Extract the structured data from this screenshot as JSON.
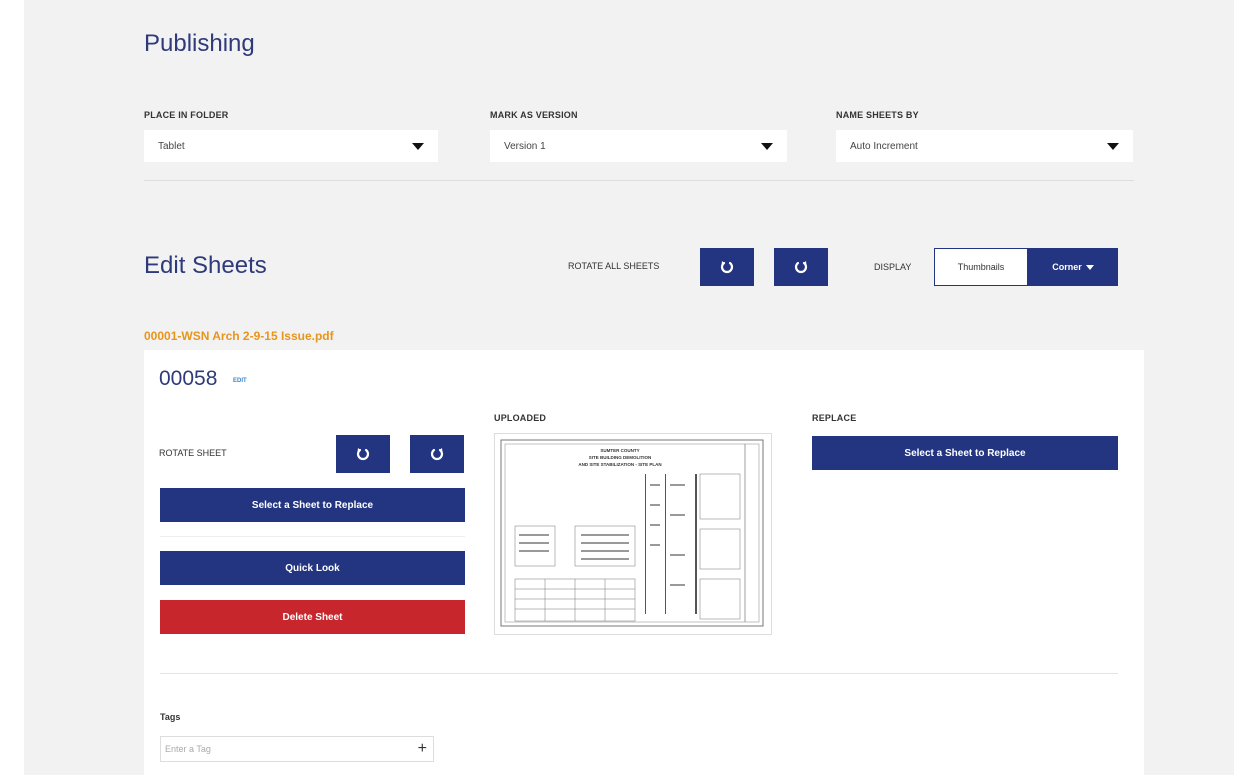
{
  "publishing": {
    "title": "Publishing",
    "place_in_folder": {
      "label": "PLACE IN FOLDER",
      "value": "Tablet"
    },
    "mark_as_version": {
      "label": "MARK AS VERSION",
      "value": "Version 1"
    },
    "name_sheets_by": {
      "label": "NAME SHEETS BY",
      "value": "Auto Increment"
    }
  },
  "edit_sheets": {
    "title": "Edit Sheets",
    "rotate_all_label": "ROTATE ALL SHEETS",
    "display_label": "DISPLAY",
    "display_options": {
      "thumbnails": "Thumbnails",
      "corner": "Corner"
    },
    "file_name": "00001-WSN Arch 2-9-15 Issue.pdf"
  },
  "sheet": {
    "number": "00058",
    "edit_label": "EDIT",
    "rotate_label": "ROTATE SHEET",
    "select_replace_label": "Select a Sheet to Replace",
    "quick_look_label": "Quick Look",
    "delete_label": "Delete Sheet",
    "uploaded_label": "UPLOADED",
    "replace_label": "REPLACE",
    "replace_button_label": "Select a Sheet to Replace",
    "thumbnail_heading": [
      "SUMTER COUNTY",
      "SITE BUILDING DEMOLITION",
      "AND SITE STABILIZATION - SITE PLAN"
    ]
  },
  "tags": {
    "label": "Tags",
    "placeholder": "Enter a Tag"
  },
  "colors": {
    "navy": "#233580",
    "red": "#c7262c",
    "orange": "#e8951c",
    "title_blue": "#2e3a7a"
  },
  "icons": [
    "rotate-ccw-icon",
    "rotate-cw-icon",
    "caret-down-icon",
    "plus-icon"
  ]
}
